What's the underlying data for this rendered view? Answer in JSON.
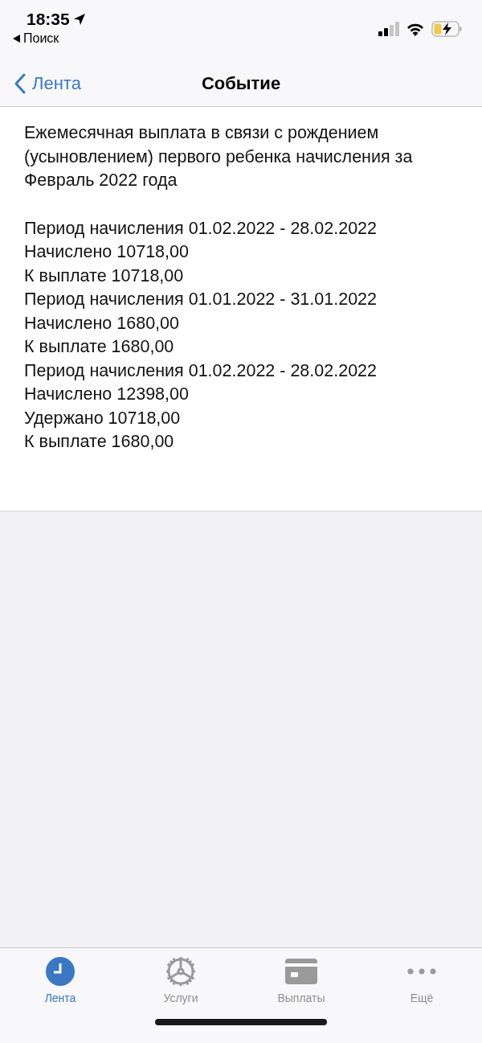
{
  "status_bar": {
    "time": "18:35",
    "back_app": "Поиск"
  },
  "nav_bar": {
    "back": "Лента",
    "title": "Событие"
  },
  "event": {
    "heading": "Ежемесячная выплата в связи с рождением (усыновлением) первого ребенка начисления за Февраль 2022 года",
    "lines": [
      "Период начисления 01.02.2022 - 28.02.2022",
      "Начислено 10718,00",
      "К выплате 10718,00",
      "Период начисления 01.01.2022 - 31.01.2022",
      "Начислено 1680,00",
      "К выплате 1680,00",
      "Период начисления 01.02.2022 - 28.02.2022",
      "Начислено 12398,00",
      "Удержано 10718,00",
      "К выплате 1680,00"
    ]
  },
  "tab_bar": [
    {
      "label": "Лента",
      "kind": "clock",
      "selected": true
    },
    {
      "label": "Услуги",
      "kind": "gear",
      "selected": false
    },
    {
      "label": "Выплаты",
      "kind": "card",
      "selected": false
    },
    {
      "label": "Ещё",
      "kind": "more",
      "selected": false
    }
  ]
}
